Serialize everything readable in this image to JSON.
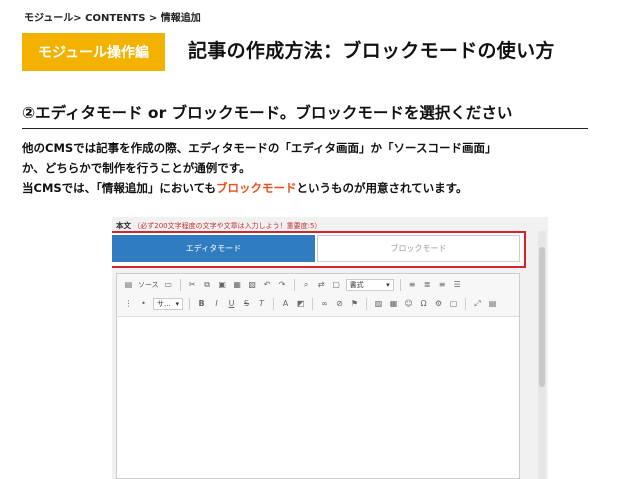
{
  "breadcrumb": "モジュール> CONTENTS > 情報追加",
  "badge": "モジュール操作編",
  "title": "記事の作成方法：ブロックモードの使い方",
  "subheading": "②エディタモード or ブロックモード。ブロックモードを選択ください",
  "body": {
    "line1": "他のCMSでは記事を作成の際、エディタモードの「エディタ画面」か「ソースコード画面」",
    "line2": "か、どちらかで制作を行うことが通例です。",
    "line3_pre": "当CMSでは、「情報追加」においても",
    "line3_highlight": "ブロックモード",
    "line3_post": "というものが用意されています。",
    "highlight_color": "#e8501e"
  },
  "screenshot": {
    "field_label": "本文",
    "field_hint": "（必ず200文字程度の文字や文章は入力しよう！重要度:5）",
    "tab_editor": "エディタモード",
    "tab_block": "ブロックモード",
    "toolbar": {
      "source": "ソース",
      "format_select": "書式",
      "size_select": "サ..."
    }
  },
  "colors": {
    "badge": "#f3b200",
    "tab_active": "#2f7dc0",
    "highlight_frame": "#d8232a"
  }
}
